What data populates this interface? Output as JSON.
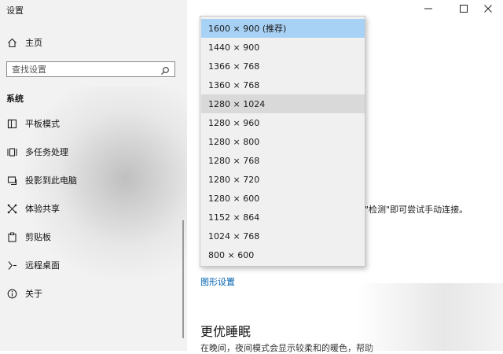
{
  "window": {
    "title": "设置"
  },
  "sidebar": {
    "home_label": "主页",
    "search_placeholder": "查找设置",
    "section_title": "系统",
    "items": [
      {
        "label": "平板模式",
        "icon": "tablet-icon"
      },
      {
        "label": "多任务处理",
        "icon": "multitask-icon"
      },
      {
        "label": "投影到此电脑",
        "icon": "project-icon"
      },
      {
        "label": "体验共享",
        "icon": "share-icon"
      },
      {
        "label": "剪贴板",
        "icon": "clipboard-icon"
      },
      {
        "label": "远程桌面",
        "icon": "remote-desktop-icon"
      },
      {
        "label": "关于",
        "icon": "info-icon"
      }
    ]
  },
  "resolution_dropdown": {
    "selected": "1600 × 900 (推荐)",
    "options": [
      "1600 × 900 (推荐)",
      "1440 × 900",
      "1366 × 768",
      "1360 × 768",
      "1280 × 1024",
      "1280 × 960",
      "1280 × 800",
      "1280 × 768",
      "1280 × 720",
      "1280 × 600",
      "1152 × 864",
      "1024 × 768",
      "800 × 600"
    ]
  },
  "main": {
    "detect_hint": "\"检测\"即可尝试手动连接。",
    "graphics_link": "图形设置",
    "sleep_heading": "更优睡眠",
    "sleep_desc": "在晚间，夜间模式会显示较柔和的暖色，帮助"
  },
  "colors": {
    "accent": "#0063b1",
    "selected_option": "#a8d2f5"
  }
}
